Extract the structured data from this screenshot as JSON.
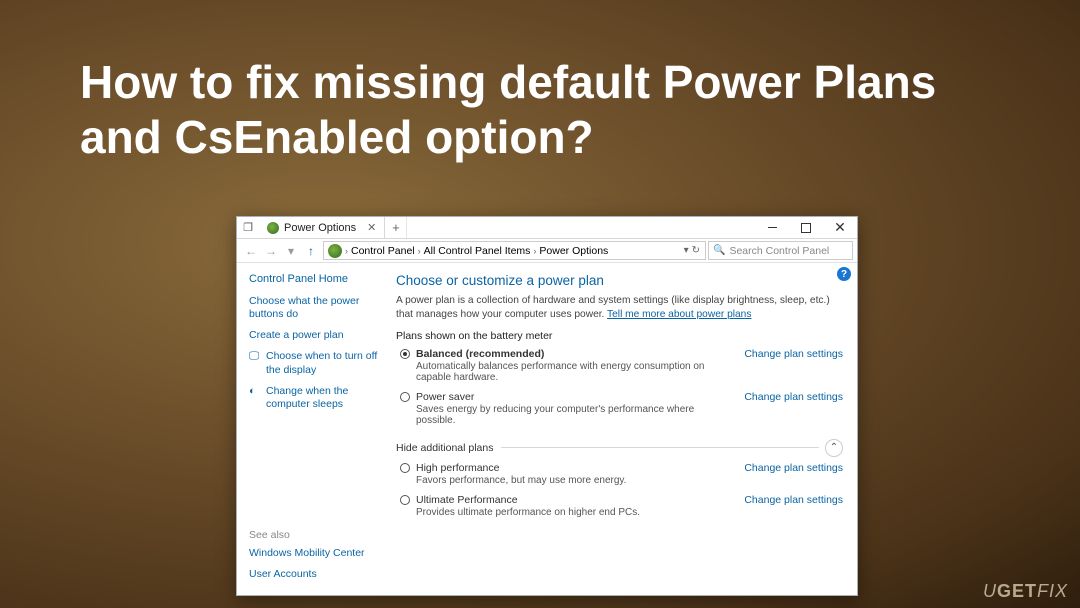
{
  "headline": "How to fix missing default Power Plans and CsEnabled option?",
  "window": {
    "tab_title": "Power Options",
    "breadcrumb": [
      "Control Panel",
      "All Control Panel Items",
      "Power Options"
    ],
    "search_placeholder": "Search Control Panel"
  },
  "sidebar": {
    "home": "Control Panel Home",
    "links": [
      "Choose what the power buttons do",
      "Create a power plan",
      "Choose when to turn off the display",
      "Change when the computer sleeps"
    ],
    "see_also_label": "See also",
    "see_also": [
      "Windows Mobility Center",
      "User Accounts"
    ]
  },
  "content": {
    "title": "Choose or customize a power plan",
    "description_a": "A power plan is a collection of hardware and system settings (like display brightness, sleep, etc.) that manages how your computer uses power. ",
    "description_link": "Tell me more about power plans",
    "battery_header": "Plans shown on the battery meter",
    "plans": [
      {
        "name": "Balanced (recommended)",
        "desc": "Automatically balances performance with energy consumption on capable hardware.",
        "checked": true,
        "bold": true
      },
      {
        "name": "Power saver",
        "desc": "Saves energy by reducing your computer's performance where possible.",
        "checked": false,
        "bold": false
      }
    ],
    "hide_label": "Hide additional plans",
    "extra_plans": [
      {
        "name": "High performance",
        "desc": "Favors performance, but may use more energy.",
        "checked": false
      },
      {
        "name": "Ultimate Performance",
        "desc": "Provides ultimate performance on higher end PCs.",
        "checked": false
      }
    ],
    "change_link": "Change plan settings"
  },
  "watermark": "UGETFIX"
}
